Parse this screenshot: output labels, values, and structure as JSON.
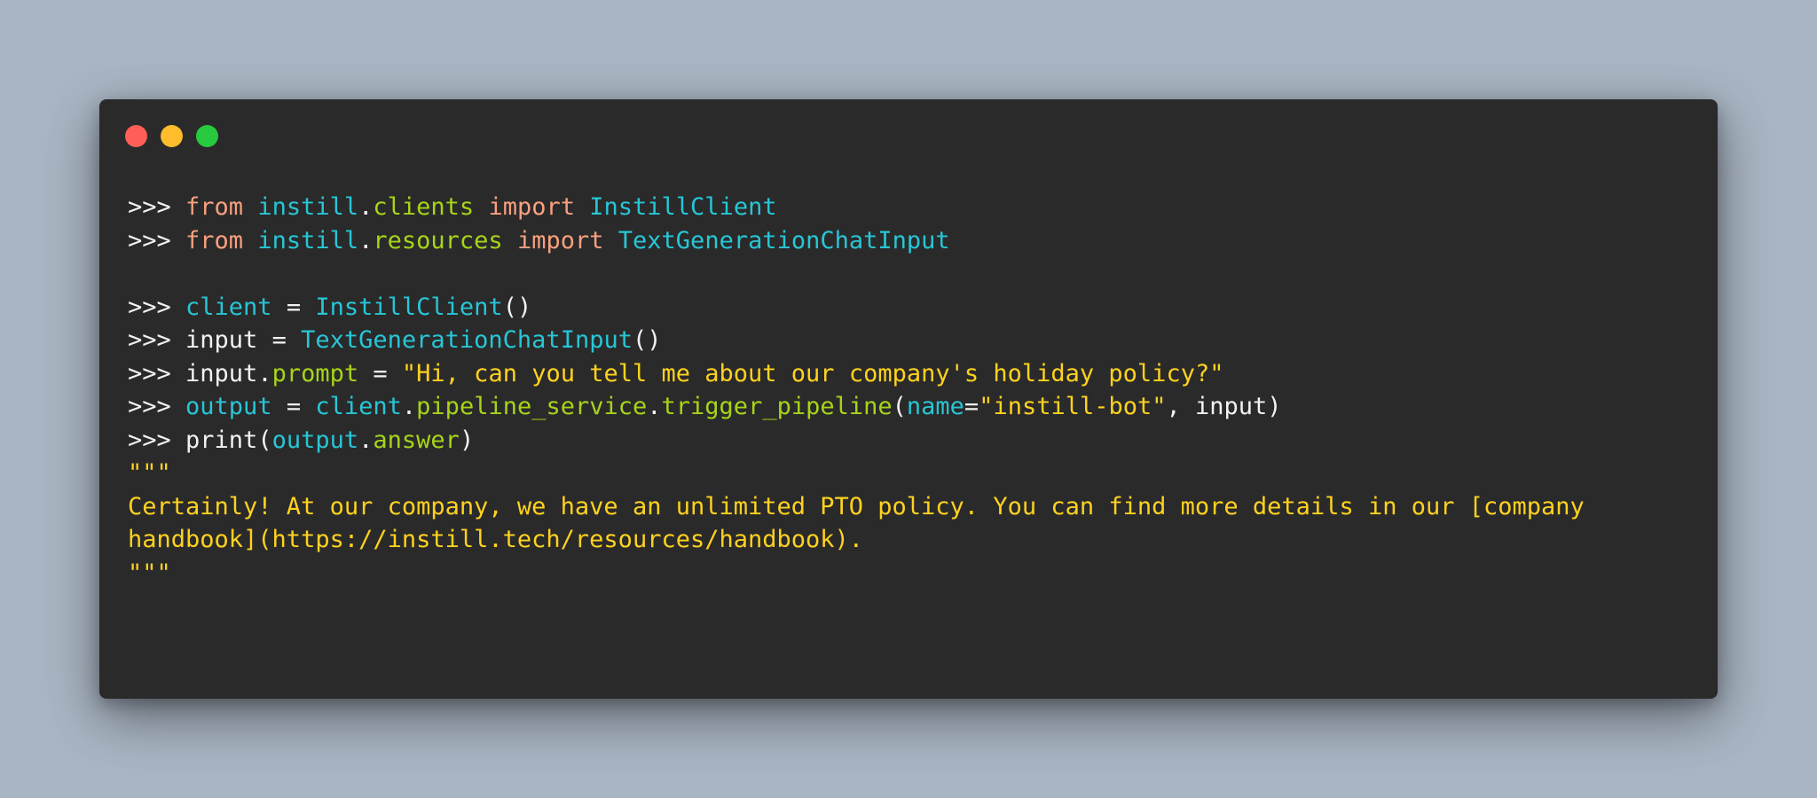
{
  "window": {
    "controls": [
      "close",
      "minimize",
      "maximize"
    ],
    "colors": {
      "background": "#2a2a2a",
      "close": "#ff5f56",
      "minimize": "#ffbd2e",
      "maximize": "#27c93f",
      "keyword": "#f9a07f",
      "identifier": "#27c6d6",
      "attribute": "#a6d41a",
      "string": "#ffd21f",
      "plain": "#f2f2f2"
    }
  },
  "code": {
    "prompt": ">>> ",
    "lines": [
      {
        "tokens": [
          {
            "t": "from",
            "c": "kw"
          },
          {
            "t": " ",
            "c": "pl"
          },
          {
            "t": "instill",
            "c": "mod"
          },
          {
            "t": ".",
            "c": "pl"
          },
          {
            "t": "clients",
            "c": "attr"
          },
          {
            "t": " ",
            "c": "pl"
          },
          {
            "t": "import",
            "c": "kw"
          },
          {
            "t": " ",
            "c": "pl"
          },
          {
            "t": "InstillClient",
            "c": "mod"
          }
        ]
      },
      {
        "tokens": [
          {
            "t": "from",
            "c": "kw"
          },
          {
            "t": " ",
            "c": "pl"
          },
          {
            "t": "instill",
            "c": "mod"
          },
          {
            "t": ".",
            "c": "pl"
          },
          {
            "t": "resources",
            "c": "attr"
          },
          {
            "t": " ",
            "c": "pl"
          },
          {
            "t": "import",
            "c": "kw"
          },
          {
            "t": " ",
            "c": "pl"
          },
          {
            "t": "TextGenerationChatInput",
            "c": "mod"
          }
        ]
      },
      {
        "blank": true,
        "tokens": []
      },
      {
        "tokens": [
          {
            "t": "client",
            "c": "mod"
          },
          {
            "t": " = ",
            "c": "pl"
          },
          {
            "t": "InstillClient",
            "c": "mod"
          },
          {
            "t": "()",
            "c": "pl"
          }
        ]
      },
      {
        "tokens": [
          {
            "t": "input",
            "c": "pl"
          },
          {
            "t": " = ",
            "c": "pl"
          },
          {
            "t": "TextGenerationChatInput",
            "c": "mod"
          },
          {
            "t": "()",
            "c": "pl"
          }
        ]
      },
      {
        "tokens": [
          {
            "t": "input",
            "c": "pl"
          },
          {
            "t": ".",
            "c": "pl"
          },
          {
            "t": "prompt",
            "c": "attr"
          },
          {
            "t": " = ",
            "c": "pl"
          },
          {
            "t": "\"Hi, can you tell me about our company's holiday policy?\"",
            "c": "str"
          }
        ]
      },
      {
        "tokens": [
          {
            "t": "output",
            "c": "mod"
          },
          {
            "t": " = ",
            "c": "pl"
          },
          {
            "t": "client",
            "c": "mod"
          },
          {
            "t": ".",
            "c": "pl"
          },
          {
            "t": "pipeline_service",
            "c": "attr"
          },
          {
            "t": ".",
            "c": "pl"
          },
          {
            "t": "trigger_pipeline",
            "c": "attr"
          },
          {
            "t": "(",
            "c": "pl"
          },
          {
            "t": "name",
            "c": "mod"
          },
          {
            "t": "=",
            "c": "pl"
          },
          {
            "t": "\"instill-bot\"",
            "c": "str"
          },
          {
            "t": ", input)",
            "c": "pl"
          }
        ]
      },
      {
        "tokens": [
          {
            "t": "print",
            "c": "pl"
          },
          {
            "t": "(",
            "c": "pl"
          },
          {
            "t": "output",
            "c": "mod"
          },
          {
            "t": ".",
            "c": "pl"
          },
          {
            "t": "answer",
            "c": "attr"
          },
          {
            "t": ")",
            "c": "pl"
          }
        ]
      }
    ],
    "output_lines": [
      "\"\"\"",
      "Certainly! At our company, we have an unlimited PTO policy. You can find more details in our [company",
      "handbook](https://instill.tech/resources/handbook).",
      "\"\"\""
    ]
  }
}
